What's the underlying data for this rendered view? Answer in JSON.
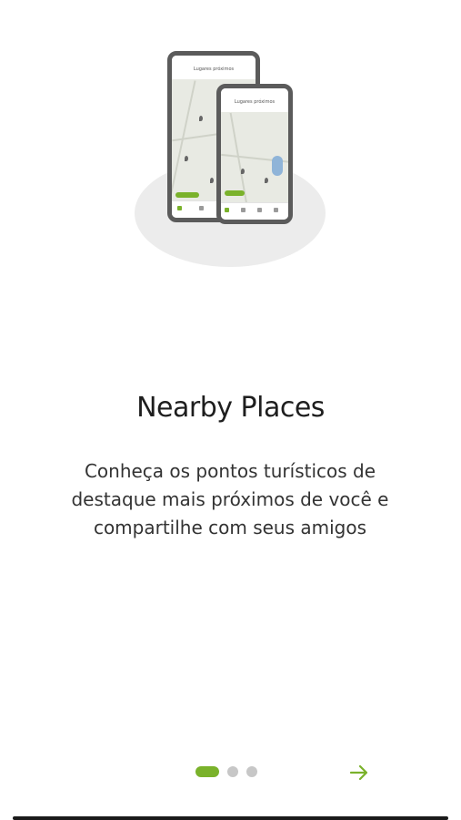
{
  "onboarding": {
    "title": "Nearby Places",
    "description": "Conheça os pontos turísticos de destaque mais próximos de você e compartilhe com seus amigos",
    "illustration": {
      "back_phone_header": "Lugares próximos",
      "front_phone_header": "Lugares próximos"
    },
    "pager": {
      "total": 3,
      "active_index": 0
    },
    "next_icon": "arrow-right-icon"
  },
  "colors": {
    "accent": "#7ab22b",
    "inactive_dot": "#c7c7c7",
    "text": "#1e1e1e"
  }
}
